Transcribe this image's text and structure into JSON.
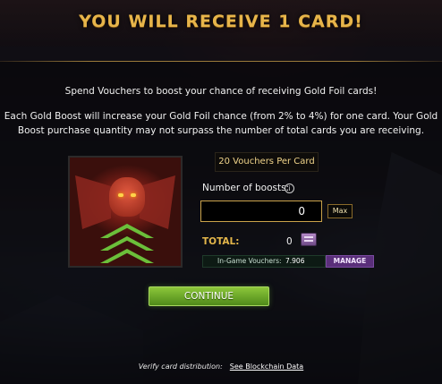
{
  "header": {
    "title": "YOU WILL RECEIVE 1 CARD!"
  },
  "intro": {
    "line1": "Spend Vouchers to boost your chance of receiving Gold Foil cards!",
    "paragraph": "Each Gold Boost will increase your Gold Foil chance (from 2% to 4%) for one card. Your Gold Boost purchase quantity may not surpass the number of total cards you are receiving."
  },
  "card": {
    "image_icon": "dragon-card-art-icon"
  },
  "vouchers_per_card": "20 Vouchers Per Card",
  "boosts": {
    "label": "Number of boosts:",
    "info_icon": "i",
    "value": "0",
    "max_label": "Max"
  },
  "total": {
    "label": "TOTAL:",
    "value": "0"
  },
  "ingame": {
    "label": "In-Game Vouchers:",
    "value": "7.906",
    "manage_label": "MANAGE"
  },
  "continue_label": "CONTINUE",
  "footer": {
    "verify_text": "Verify card distribution:",
    "link_text": "See Blockchain Data"
  },
  "colors": {
    "accent_gold": "#e7b54a",
    "continue_green": "#6bbf3a",
    "manage_purple": "#5a2f7a"
  }
}
